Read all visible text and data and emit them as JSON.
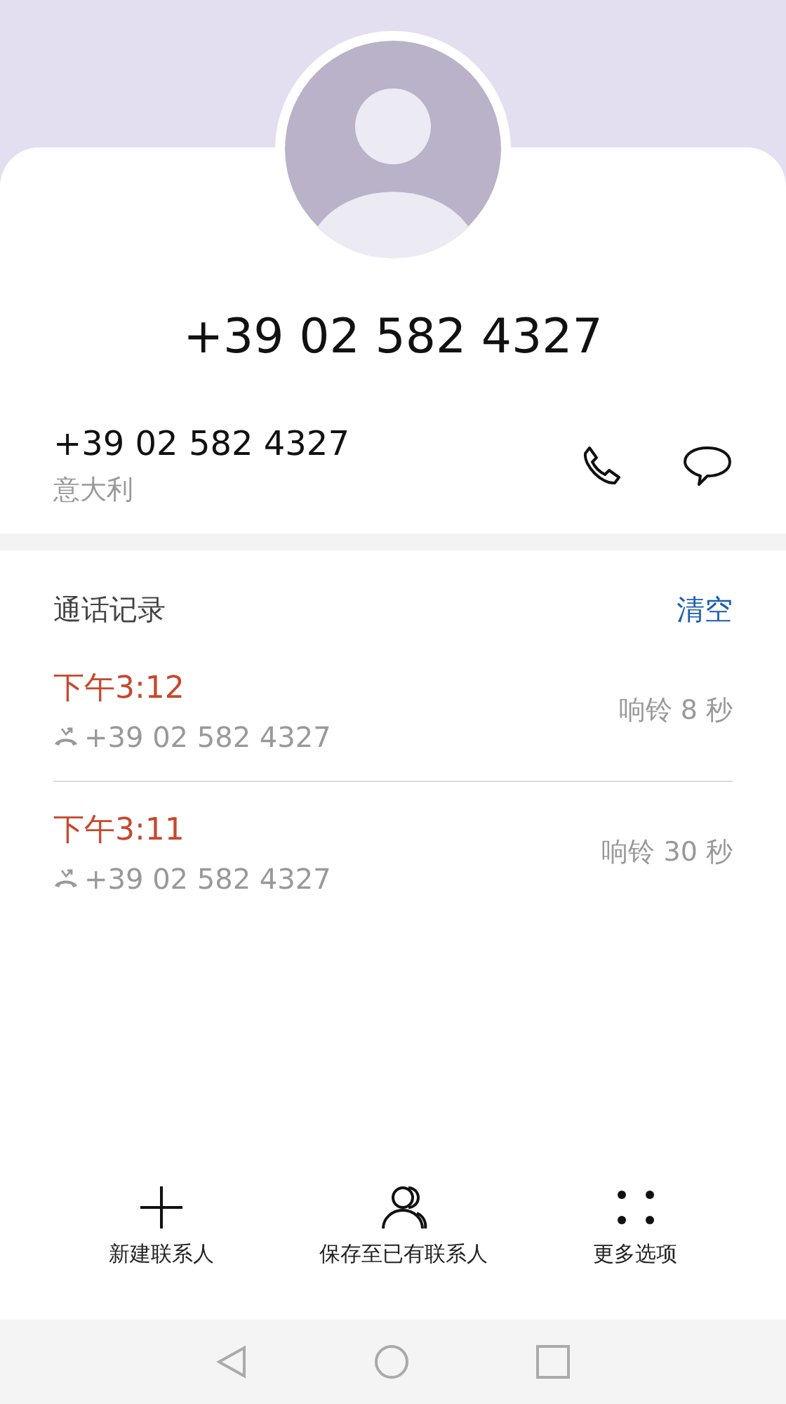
{
  "header": {
    "title": "+39 02 582 4327"
  },
  "number": {
    "value": "+39 02 582 4327",
    "region": "意大利"
  },
  "call_log": {
    "title": "通话记录",
    "clear": "清空",
    "calls": [
      {
        "time": "下午3:12",
        "number": "+39 02 582 4327",
        "duration": "响铃 8 秒",
        "kind": "missed"
      },
      {
        "time": "下午3:11",
        "number": "+39 02 582 4327",
        "duration": "响铃 30 秒",
        "kind": "missed"
      }
    ]
  },
  "actions": [
    {
      "label": "新建联系人",
      "kind": "add"
    },
    {
      "label": "保存至已有联系人",
      "kind": "person"
    },
    {
      "label": "更多选项",
      "kind": "more"
    }
  ]
}
